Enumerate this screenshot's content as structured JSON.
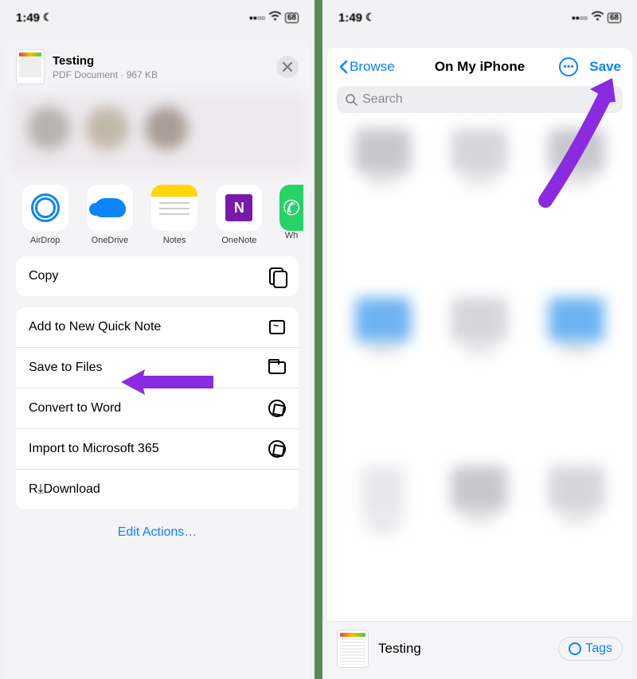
{
  "status": {
    "time": "1:49",
    "battery": "68"
  },
  "share": {
    "file": {
      "title": "Testing",
      "subtitle": "PDF Document · 967 KB"
    },
    "apps": {
      "airdrop": "AirDrop",
      "onedrive": "OneDrive",
      "notes": "Notes",
      "onenote": "OneNote",
      "whatsapp": "Wh"
    },
    "actions": {
      "copy": "Copy",
      "quicknote": "Add to New Quick Note",
      "savefiles": "Save to Files",
      "convert": "Convert to Word",
      "import365": "Import to Microsoft 365",
      "download": "R⤓Download"
    },
    "edit": "Edit Actions…"
  },
  "files": {
    "back": "Browse",
    "title": "On My iPhone",
    "save": "Save",
    "searchPlaceholder": "Search",
    "bottomTitle": "Testing",
    "tags": "Tags"
  },
  "colors": {
    "accent": "#0a84ff",
    "annotation": "#8a2be2"
  }
}
